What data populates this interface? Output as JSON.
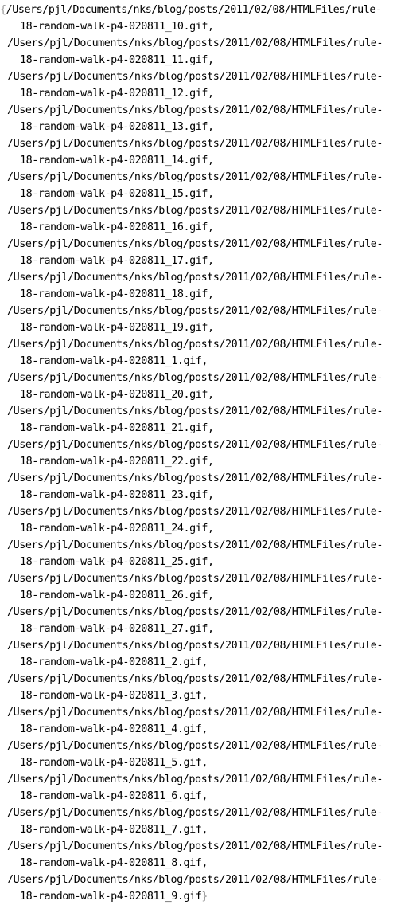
{
  "list": {
    "open_brace": "{",
    "close_brace": "}",
    "separator": ",",
    "entries": [
      {
        "line1": "/Users/pjl/Documents/nks/blog/posts/2011/02/08/HTMLFiles/rule-",
        "line2": "18-random-walk-p4-020811_10.gif"
      },
      {
        "line1": "/Users/pjl/Documents/nks/blog/posts/2011/02/08/HTMLFiles/rule-",
        "line2": "18-random-walk-p4-020811_11.gif"
      },
      {
        "line1": "/Users/pjl/Documents/nks/blog/posts/2011/02/08/HTMLFiles/rule-",
        "line2": "18-random-walk-p4-020811_12.gif"
      },
      {
        "line1": "/Users/pjl/Documents/nks/blog/posts/2011/02/08/HTMLFiles/rule-",
        "line2": "18-random-walk-p4-020811_13.gif"
      },
      {
        "line1": "/Users/pjl/Documents/nks/blog/posts/2011/02/08/HTMLFiles/rule-",
        "line2": "18-random-walk-p4-020811_14.gif"
      },
      {
        "line1": "/Users/pjl/Documents/nks/blog/posts/2011/02/08/HTMLFiles/rule-",
        "line2": "18-random-walk-p4-020811_15.gif"
      },
      {
        "line1": "/Users/pjl/Documents/nks/blog/posts/2011/02/08/HTMLFiles/rule-",
        "line2": "18-random-walk-p4-020811_16.gif"
      },
      {
        "line1": "/Users/pjl/Documents/nks/blog/posts/2011/02/08/HTMLFiles/rule-",
        "line2": "18-random-walk-p4-020811_17.gif"
      },
      {
        "line1": "/Users/pjl/Documents/nks/blog/posts/2011/02/08/HTMLFiles/rule-",
        "line2": "18-random-walk-p4-020811_18.gif"
      },
      {
        "line1": "/Users/pjl/Documents/nks/blog/posts/2011/02/08/HTMLFiles/rule-",
        "line2": "18-random-walk-p4-020811_19.gif"
      },
      {
        "line1": "/Users/pjl/Documents/nks/blog/posts/2011/02/08/HTMLFiles/rule-",
        "line2": "18-random-walk-p4-020811_1.gif"
      },
      {
        "line1": "/Users/pjl/Documents/nks/blog/posts/2011/02/08/HTMLFiles/rule-",
        "line2": "18-random-walk-p4-020811_20.gif"
      },
      {
        "line1": "/Users/pjl/Documents/nks/blog/posts/2011/02/08/HTMLFiles/rule-",
        "line2": "18-random-walk-p4-020811_21.gif"
      },
      {
        "line1": "/Users/pjl/Documents/nks/blog/posts/2011/02/08/HTMLFiles/rule-",
        "line2": "18-random-walk-p4-020811_22.gif"
      },
      {
        "line1": "/Users/pjl/Documents/nks/blog/posts/2011/02/08/HTMLFiles/rule-",
        "line2": "18-random-walk-p4-020811_23.gif"
      },
      {
        "line1": "/Users/pjl/Documents/nks/blog/posts/2011/02/08/HTMLFiles/rule-",
        "line2": "18-random-walk-p4-020811_24.gif"
      },
      {
        "line1": "/Users/pjl/Documents/nks/blog/posts/2011/02/08/HTMLFiles/rule-",
        "line2": "18-random-walk-p4-020811_25.gif"
      },
      {
        "line1": "/Users/pjl/Documents/nks/blog/posts/2011/02/08/HTMLFiles/rule-",
        "line2": "18-random-walk-p4-020811_26.gif"
      },
      {
        "line1": "/Users/pjl/Documents/nks/blog/posts/2011/02/08/HTMLFiles/rule-",
        "line2": "18-random-walk-p4-020811_27.gif"
      },
      {
        "line1": "/Users/pjl/Documents/nks/blog/posts/2011/02/08/HTMLFiles/rule-",
        "line2": "18-random-walk-p4-020811_2.gif"
      },
      {
        "line1": "/Users/pjl/Documents/nks/blog/posts/2011/02/08/HTMLFiles/rule-",
        "line2": "18-random-walk-p4-020811_3.gif"
      },
      {
        "line1": "/Users/pjl/Documents/nks/blog/posts/2011/02/08/HTMLFiles/rule-",
        "line2": "18-random-walk-p4-020811_4.gif"
      },
      {
        "line1": "/Users/pjl/Documents/nks/blog/posts/2011/02/08/HTMLFiles/rule-",
        "line2": "18-random-walk-p4-020811_5.gif"
      },
      {
        "line1": "/Users/pjl/Documents/nks/blog/posts/2011/02/08/HTMLFiles/rule-",
        "line2": "18-random-walk-p4-020811_6.gif"
      },
      {
        "line1": "/Users/pjl/Documents/nks/blog/posts/2011/02/08/HTMLFiles/rule-",
        "line2": "18-random-walk-p4-020811_7.gif"
      },
      {
        "line1": "/Users/pjl/Documents/nks/blog/posts/2011/02/08/HTMLFiles/rule-",
        "line2": "18-random-walk-p4-020811_8.gif"
      },
      {
        "line1": "/Users/pjl/Documents/nks/blog/posts/2011/02/08/HTMLFiles/rule-",
        "line2": "18-random-walk-p4-020811_9.gif"
      }
    ]
  },
  "colors": {
    "text": "#000000",
    "brace": "#9a9a9a",
    "background": "#ffffff"
  }
}
